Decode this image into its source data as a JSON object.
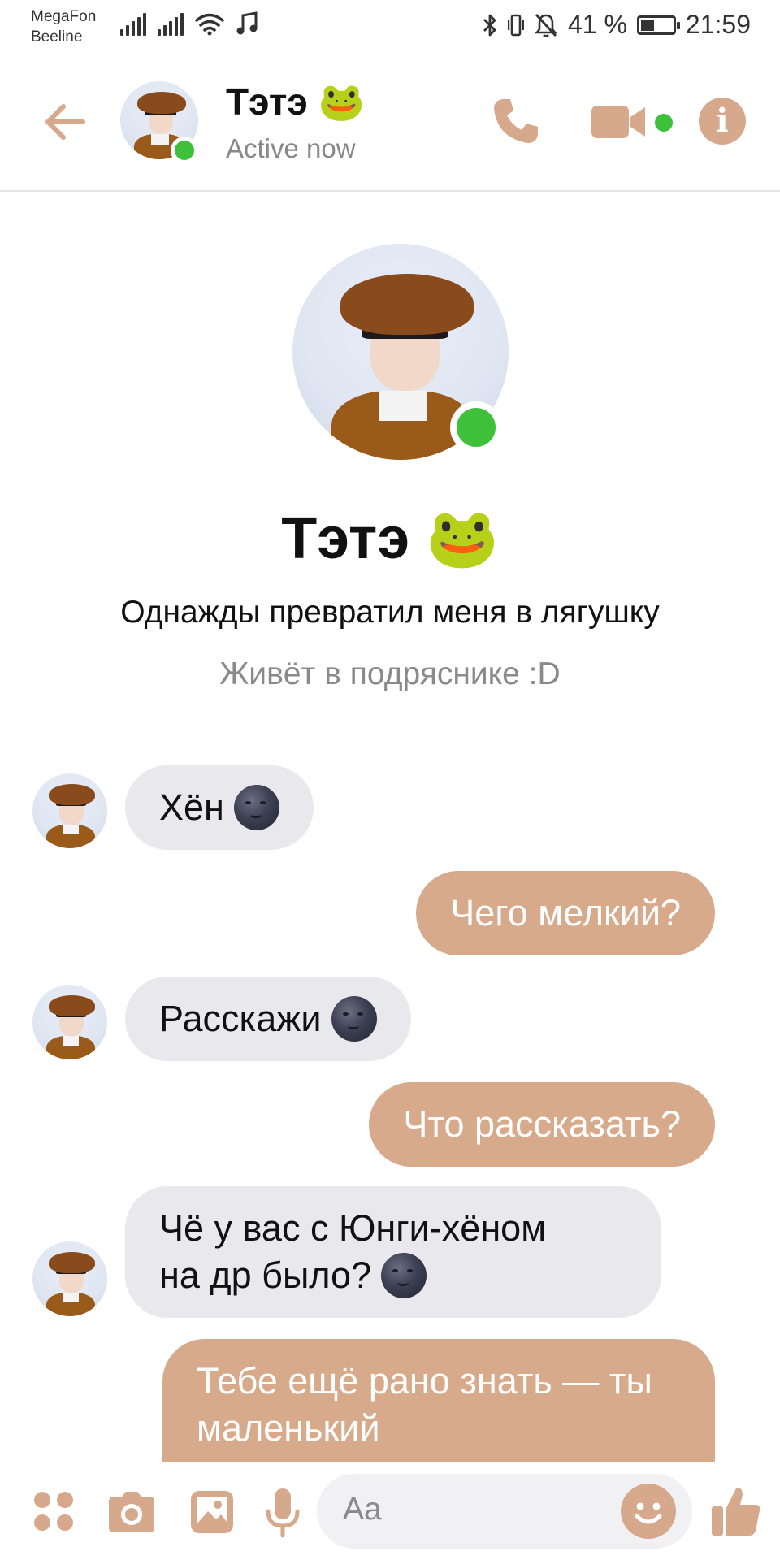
{
  "status_bar": {
    "carrier1": "MegaFon",
    "carrier2": "Beeline",
    "battery_percent": "41 %",
    "battery_level": 0.41,
    "time": "21:59"
  },
  "header": {
    "name": "Тэтэ 🐸",
    "status": "Active now"
  },
  "profile": {
    "name": "Тэтэ 🐸",
    "bio": "Однажды превратил меня в лягушку",
    "location": "Живёт в подряснике :D"
  },
  "messages": [
    {
      "direction": "in",
      "text": "Хён"
    },
    {
      "direction": "out",
      "text": "Чего мелкий?"
    },
    {
      "direction": "in",
      "text": "Расскажи"
    },
    {
      "direction": "out",
      "text": "Что рассказать?"
    },
    {
      "direction": "in",
      "line1": "Чё у вас с Юнги-хёном",
      "line2": "на др было?"
    },
    {
      "direction": "out",
      "line1": "Тебе ещё рано знать — ты",
      "line2": "маленький"
    }
  ],
  "composer": {
    "placeholder": "Aa"
  },
  "colors": {
    "accent": "#d7a98c",
    "online": "#3fc03a",
    "incoming_bubble": "#e9e8ec"
  },
  "icons": [
    "back-arrow-icon",
    "phone-icon",
    "video-camera-icon",
    "info-icon",
    "apps-grid-icon",
    "camera-icon",
    "gallery-icon",
    "microphone-icon",
    "emoji-icon",
    "thumbs-up-icon",
    "moon-emoji-icon"
  ]
}
